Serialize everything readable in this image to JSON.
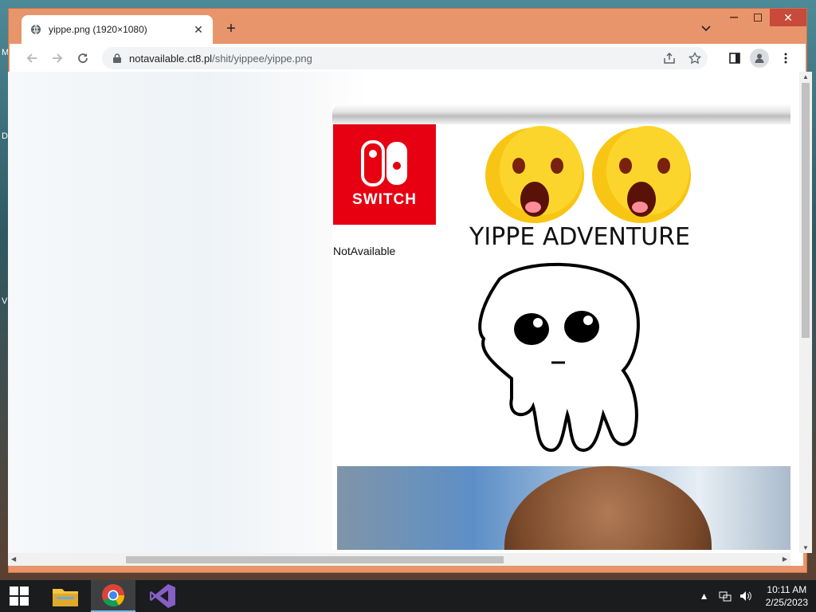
{
  "desktop": {
    "edge_letters": [
      "M",
      "D",
      "V"
    ]
  },
  "browser": {
    "tab": {
      "title": "yippe.png (1920×1080)",
      "new_tab_symbol": "+"
    },
    "url": {
      "host": "notavailable.ct8.pl",
      "path": "/shit/yippee/yippe.png"
    }
  },
  "image": {
    "logo_brand": "SWITCH",
    "headline": "YIPPE ADVENTURE",
    "caption": "NotAvailable",
    "logo_color": "#e60012"
  },
  "taskbar": {
    "apps": [
      "windows-start",
      "file-explorer",
      "chrome",
      "visual-studio"
    ],
    "clock": {
      "time": "10:11 AM",
      "date": "2/25/2023"
    }
  }
}
